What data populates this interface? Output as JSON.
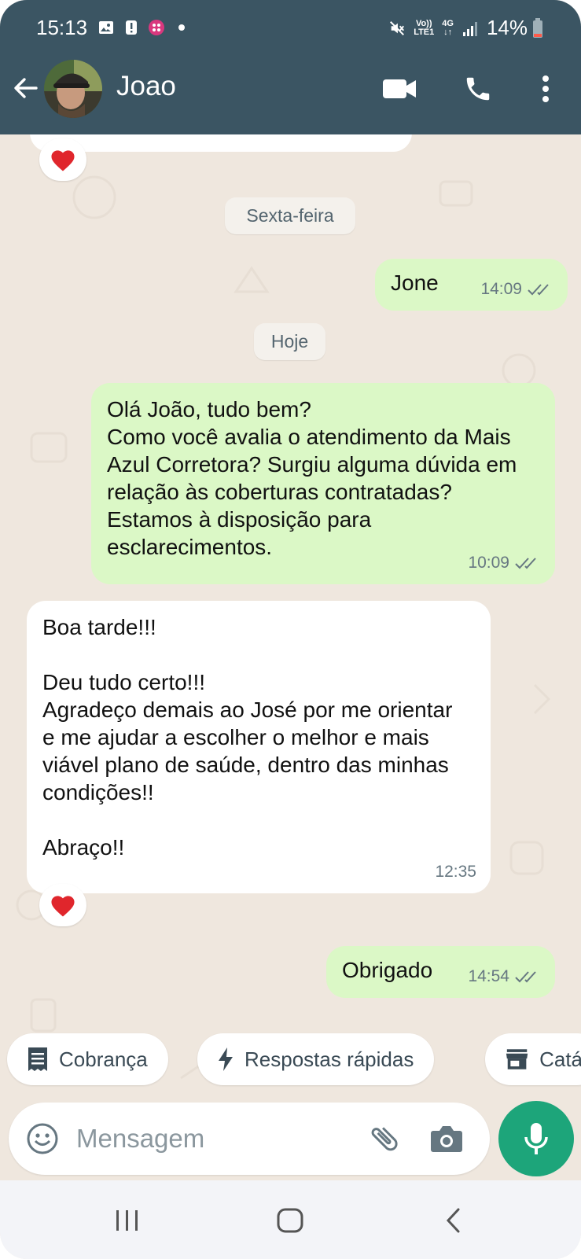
{
  "status_bar": {
    "time": "15:13",
    "lte_top": "Vo))",
    "lte_bottom": "LTE1",
    "net_top": "4G",
    "net_bottom": "↓↑",
    "battery": "14%"
  },
  "header": {
    "contact_name": "Joao"
  },
  "chat": {
    "date_chips": [
      "Sexta-feira",
      "Hoje"
    ],
    "messages": [
      {
        "direction": "out",
        "text": "Jone",
        "time": "14:09",
        "read": true
      },
      {
        "direction": "out",
        "text": "Olá João, tudo bem?\nComo você avalia o atendimento da Mais Azul Corretora? Surgiu alguma dúvida em relação às coberturas contratadas? Estamos à disposição para esclarecimentos.",
        "time": "10:09",
        "read": true
      },
      {
        "direction": "in",
        "text": "Boa tarde!!!\n\nDeu tudo certo!!!\nAgradeço demais ao José por me orientar e me ajudar a escolher o melhor e mais viável plano de saúde, dentro das minhas condições!!\n\nAbraço!!",
        "time": "12:35",
        "reaction": "heart"
      },
      {
        "direction": "out",
        "text": "Obrigado",
        "time": "14:54",
        "read": true
      }
    ]
  },
  "quick_chips": [
    "Cobrança",
    "Respostas rápidas",
    "Catá"
  ],
  "composer": {
    "placeholder": "Mensagem"
  },
  "colors": {
    "header": "#3b5563",
    "outgoing_bubble": "#dbf8c6",
    "incoming_bubble": "#ffffff",
    "chat_background": "#efe7de",
    "mic_button": "#1da57a",
    "ticks": "#667781"
  },
  "icons": {
    "header": [
      "arrow-back-icon",
      "video-call-icon",
      "voice-call-icon",
      "more-vert-icon"
    ],
    "composer": [
      "emoji-icon",
      "attach-icon",
      "camera-icon",
      "mic-icon"
    ],
    "nav": [
      "recent-apps-icon",
      "home-icon",
      "back-icon"
    ]
  }
}
